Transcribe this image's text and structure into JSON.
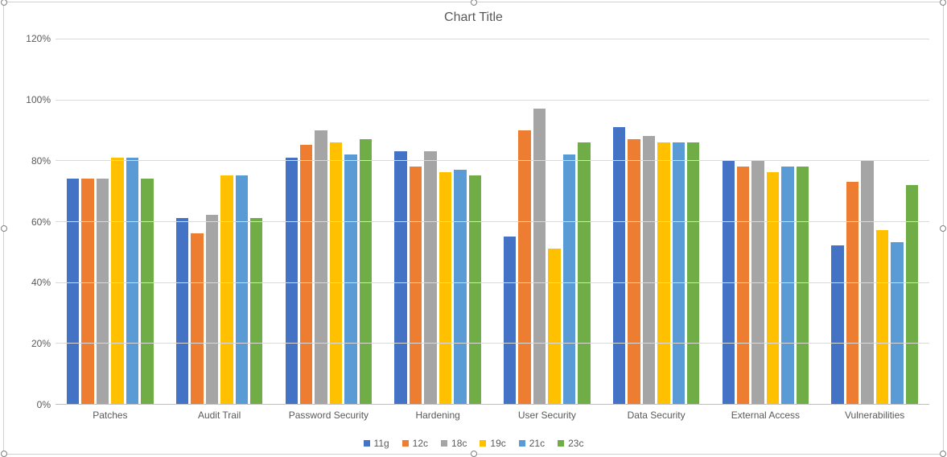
{
  "chart_data": {
    "type": "bar",
    "title": "Chart Title",
    "xlabel": "",
    "ylabel": "",
    "ylim": [
      0,
      120
    ],
    "y_ticks": [
      0,
      20,
      40,
      60,
      80,
      100,
      120
    ],
    "y_tick_labels": [
      "0%",
      "20%",
      "40%",
      "60%",
      "80%",
      "100%",
      "120%"
    ],
    "categories": [
      "Patches",
      "Audit Trail",
      "Password Security",
      "Hardening",
      "User Security",
      "Data Security",
      "External Access",
      "Vulnerabilities"
    ],
    "series": [
      {
        "name": "11g",
        "color": "#4472C4",
        "values": [
          74,
          61,
          81,
          83,
          55,
          91,
          80,
          52
        ]
      },
      {
        "name": "12c",
        "color": "#ED7D31",
        "values": [
          74,
          56,
          85,
          78,
          90,
          87,
          78,
          73
        ]
      },
      {
        "name": "18c",
        "color": "#A5A5A5",
        "values": [
          74,
          62,
          90,
          83,
          97,
          88,
          80,
          80
        ]
      },
      {
        "name": "19c",
        "color": "#FFC000",
        "values": [
          81,
          75,
          86,
          76,
          51,
          86,
          76,
          57
        ]
      },
      {
        "name": "21c",
        "color": "#5B9BD5",
        "values": [
          81,
          75,
          82,
          77,
          82,
          86,
          78,
          53
        ]
      },
      {
        "name": "23c",
        "color": "#70AD47",
        "values": [
          74,
          61,
          87,
          75,
          86,
          86,
          78,
          72
        ]
      }
    ]
  }
}
